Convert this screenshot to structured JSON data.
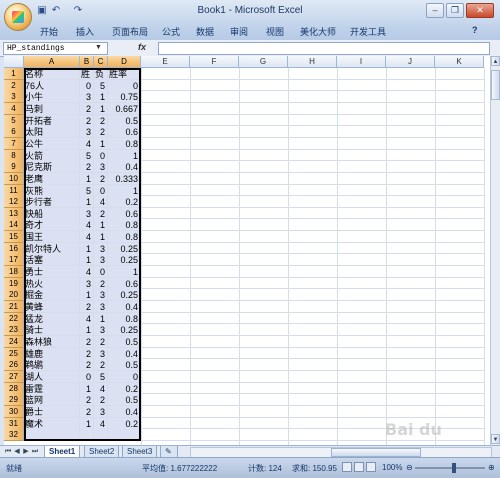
{
  "window": {
    "title": "Book1 - Microsoft Excel",
    "minimize": "–",
    "restore": "❐",
    "close": "✕"
  },
  "quick_access": {
    "save_icon": "save-icon",
    "undo_icon": "undo-icon",
    "redo_icon": "redo-icon"
  },
  "ribbon": {
    "tabs": [
      "开始",
      "插入",
      "页面布局",
      "公式",
      "数据",
      "审阅",
      "视图",
      "美化大师",
      "开发工具"
    ],
    "help": "?"
  },
  "formula_bar": {
    "name_box": "HP_standings",
    "fx": "fx",
    "formula": ""
  },
  "columns": [
    "A",
    "B",
    "C",
    "D",
    "E",
    "F",
    "G",
    "H",
    "I",
    "J",
    "K"
  ],
  "rows": [
    [
      "名称",
      "胜",
      "负",
      "胜率"
    ],
    [
      "76人",
      "0",
      "5",
      "0"
    ],
    [
      "小牛",
      "3",
      "1",
      "0.75"
    ],
    [
      "马刺",
      "2",
      "1",
      "0.667"
    ],
    [
      "开拓者",
      "2",
      "2",
      "0.5"
    ],
    [
      "太阳",
      "3",
      "2",
      "0.6"
    ],
    [
      "公牛",
      "4",
      "1",
      "0.8"
    ],
    [
      "火箭",
      "5",
      "0",
      "1"
    ],
    [
      "尼克斯",
      "2",
      "3",
      "0.4"
    ],
    [
      "老鹰",
      "1",
      "2",
      "0.333"
    ],
    [
      "灰熊",
      "5",
      "0",
      "1"
    ],
    [
      "步行者",
      "1",
      "4",
      "0.2"
    ],
    [
      "快船",
      "3",
      "2",
      "0.6"
    ],
    [
      "奇才",
      "4",
      "1",
      "0.8"
    ],
    [
      "国王",
      "4",
      "1",
      "0.8"
    ],
    [
      "凯尔特人",
      "1",
      "3",
      "0.25"
    ],
    [
      "活塞",
      "1",
      "3",
      "0.25"
    ],
    [
      "勇士",
      "4",
      "0",
      "1"
    ],
    [
      "热火",
      "3",
      "2",
      "0.6"
    ],
    [
      "掘金",
      "1",
      "3",
      "0.25"
    ],
    [
      "黄蜂",
      "2",
      "3",
      "0.4"
    ],
    [
      "猛龙",
      "4",
      "1",
      "0.8"
    ],
    [
      "骑士",
      "1",
      "3",
      "0.25"
    ],
    [
      "森林狼",
      "2",
      "2",
      "0.5"
    ],
    [
      "雄鹿",
      "2",
      "3",
      "0.4"
    ],
    [
      "鹈鹕",
      "2",
      "2",
      "0.5"
    ],
    [
      "湖人",
      "0",
      "5",
      "0"
    ],
    [
      "雷霆",
      "1",
      "4",
      "0.2"
    ],
    [
      "篮网",
      "2",
      "2",
      "0.5"
    ],
    [
      "爵士",
      "2",
      "3",
      "0.4"
    ],
    [
      "魔术",
      "1",
      "4",
      "0.2"
    ],
    [
      "",
      "",
      "",
      ""
    ]
  ],
  "sheets": [
    "Sheet1",
    "Sheet2",
    "Sheet3"
  ],
  "status": {
    "ready": "就绪",
    "average": "平均值: 1.677222222",
    "count": "计数: 124",
    "sum": "求和: 150.95",
    "zoom": "100%"
  },
  "watermark": "Bai du"
}
